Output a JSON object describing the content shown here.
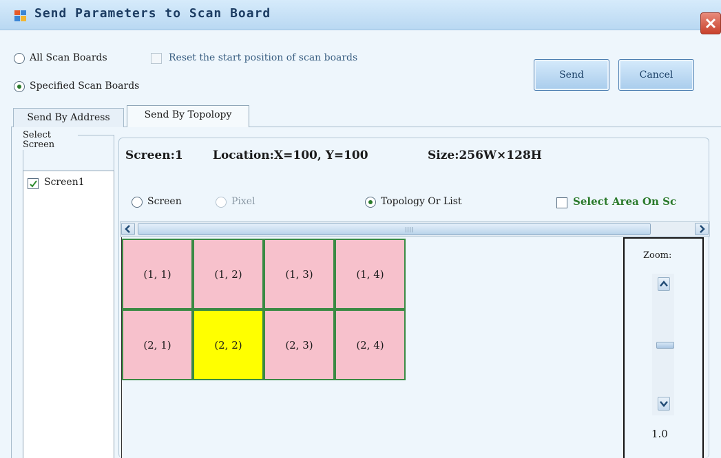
{
  "window": {
    "title": "Send Parameters to Scan Board"
  },
  "options": {
    "all_scan_boards": "All Scan Boards",
    "reset_start_position": "Reset the start position of scan boards",
    "specified_scan_boards": "Specified Scan Boards"
  },
  "buttons": {
    "send": "Send",
    "cancel": "Cancel"
  },
  "tabs": [
    {
      "label": "Send By Address",
      "active": false
    },
    {
      "label": "Send By Topolopy",
      "active": true
    }
  ],
  "select_screen": {
    "legend": "Select Screen",
    "items": [
      {
        "label": "Screen1",
        "checked": true
      }
    ]
  },
  "screen_info": {
    "screen": "Screen:1",
    "location": "Location:X=100, Y=100",
    "size": "Size:256W×128H"
  },
  "view_modes": {
    "screen": "Screen",
    "pixel": "Pixel",
    "topology": "Topology Or List",
    "select_area": "Select Area On Sc"
  },
  "grid": {
    "rows": [
      [
        "(1, 1)",
        "(1, 2)",
        "(1, 3)",
        "(1, 4)"
      ],
      [
        "(2, 1)",
        "(2, 2)",
        "(2, 3)",
        "(2, 4)"
      ]
    ],
    "highlighted": "(2, 2)",
    "colors": {
      "cell": "#f7c1cc",
      "highlight": "#ffff00",
      "border": "#3a8a43"
    }
  },
  "zoom": {
    "label": "Zoom:",
    "value": "1.0"
  }
}
